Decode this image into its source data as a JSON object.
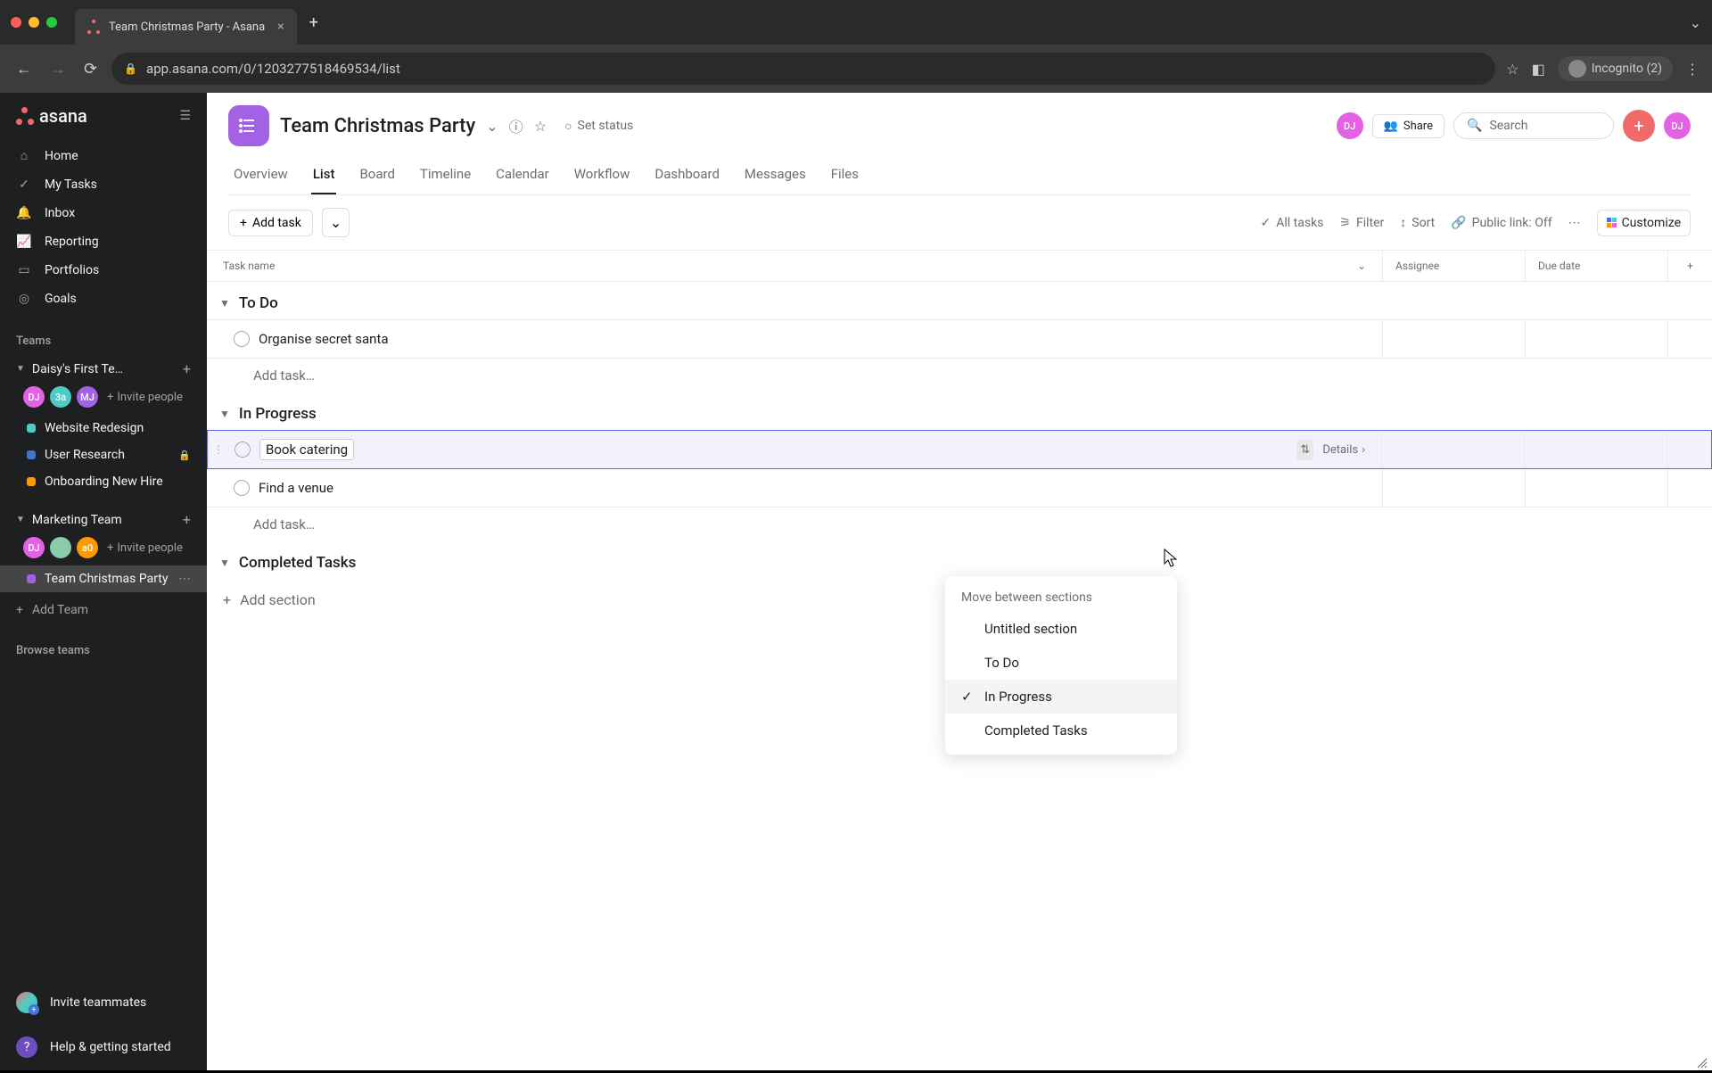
{
  "browser": {
    "tab_title": "Team Christmas Party - Asana",
    "url": "app.asana.com/0/1203277518469534/list",
    "incognito": "Incognito (2)"
  },
  "sidebar": {
    "logo": "asana",
    "nav": [
      {
        "icon": "home",
        "label": "Home"
      },
      {
        "icon": "check",
        "label": "My Tasks"
      },
      {
        "icon": "bell",
        "label": "Inbox"
      },
      {
        "icon": "chart",
        "label": "Reporting"
      },
      {
        "icon": "folder",
        "label": "Portfolios"
      },
      {
        "icon": "target",
        "label": "Goals"
      }
    ],
    "teams_label": "Teams",
    "teams": [
      {
        "name": "Daisy's First Te…",
        "members": [
          "DJ",
          "3a",
          "MJ"
        ],
        "invite": "Invite people",
        "projects": [
          {
            "name": "Website Redesign",
            "color": "pd-teal"
          },
          {
            "name": "User Research",
            "color": "pd-blue",
            "locked": true
          },
          {
            "name": "Onboarding New Hire",
            "color": "pd-orange"
          }
        ]
      },
      {
        "name": "Marketing Team",
        "members": [
          "DJ",
          "img",
          "a0"
        ],
        "invite": "Invite people",
        "projects": [
          {
            "name": "Team Christmas Party",
            "color": "pd-purple",
            "active": true
          }
        ]
      }
    ],
    "add_team": "Add Team",
    "browse_teams": "Browse teams",
    "invite_teammates": "Invite teammates",
    "help": "Help & getting started"
  },
  "project": {
    "title": "Team Christmas Party",
    "set_status": "Set status",
    "share": "Share",
    "search_placeholder": "Search",
    "user_initials": "DJ",
    "tabs": [
      "Overview",
      "List",
      "Board",
      "Timeline",
      "Calendar",
      "Workflow",
      "Dashboard",
      "Messages",
      "Files"
    ],
    "active_tab": "List"
  },
  "toolbar": {
    "add_task": "Add task",
    "all_tasks": "All tasks",
    "filter": "Filter",
    "sort": "Sort",
    "public_link": "Public link: Off",
    "customize": "Customize"
  },
  "columns": {
    "task_name": "Task name",
    "assignee": "Assignee",
    "due_date": "Due date"
  },
  "sections": [
    {
      "name": "To Do",
      "tasks": [
        {
          "name": "Organise secret santa"
        }
      ]
    },
    {
      "name": "In Progress",
      "tasks": [
        {
          "name": "Book catering",
          "selected": true,
          "details": "Details"
        },
        {
          "name": "Find a venue"
        }
      ]
    },
    {
      "name": "Completed Tasks",
      "tasks": []
    }
  ],
  "add_task_placeholder": "Add task…",
  "add_section": "Add section",
  "context_menu": {
    "header": "Move between sections",
    "items": [
      {
        "label": "Untitled section"
      },
      {
        "label": "To Do"
      },
      {
        "label": "In Progress",
        "checked": true
      },
      {
        "label": "Completed Tasks"
      }
    ]
  }
}
